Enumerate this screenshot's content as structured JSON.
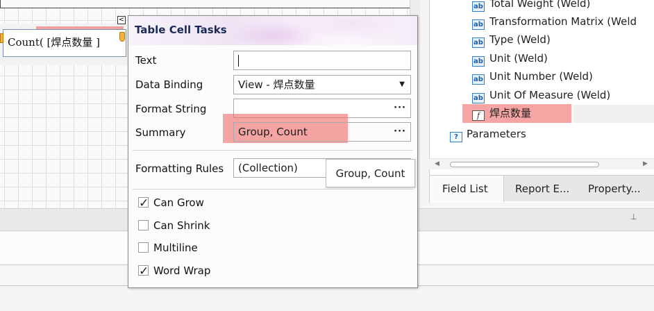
{
  "designer": {
    "cell_text": "Count( [焊点数量 ]"
  },
  "popup": {
    "title": "Table Cell Tasks",
    "rows": {
      "text_label": "Text",
      "text_value": "",
      "binding_label": "Data Binding",
      "binding_value": "View - 焊点数量",
      "format_label": "Format String",
      "format_value": "",
      "summary_label": "Summary",
      "summary_value": "Group, Count",
      "rules_label": "Formatting Rules",
      "rules_value": "(Collection)"
    },
    "ellipsis": "···",
    "dropdown_arrow": "▼",
    "tooltip": "Group, Count",
    "checks": [
      {
        "label": "Can Grow",
        "checked": true
      },
      {
        "label": "Can Shrink",
        "checked": false
      },
      {
        "label": "Multiline",
        "checked": false
      },
      {
        "label": "Word Wrap",
        "checked": true
      }
    ]
  },
  "field_list": {
    "items": [
      {
        "label": "Total Weight (Weld)",
        "icon": "text-field-icon",
        "icon_text": "ab"
      },
      {
        "label": "Transformation Matrix (Weld",
        "icon": "text-field-icon",
        "icon_text": "ab"
      },
      {
        "label": "Type (Weld)",
        "icon": "text-field-icon",
        "icon_text": "ab"
      },
      {
        "label": "Unit (Weld)",
        "icon": "text-field-icon",
        "icon_text": "ab"
      },
      {
        "label": "Unit Number (Weld)",
        "icon": "text-field-icon",
        "icon_text": "ab"
      },
      {
        "label": "Unit Of Measure (Weld)",
        "icon": "text-field-icon",
        "icon_text": "ab"
      },
      {
        "label": "焊点数量",
        "icon": "calculated-field-icon",
        "icon_text": "f"
      }
    ],
    "parameters": {
      "label": "Parameters",
      "icon": "parameters-icon",
      "icon_text": "?"
    }
  },
  "tabs": [
    {
      "label": "Field List",
      "active": true
    },
    {
      "label": "Report E...",
      "active": false
    },
    {
      "label": "Property...",
      "active": false
    }
  ],
  "colors": {
    "highlight": "#f06e6e",
    "popup_title": "#1b2b55",
    "field_icon": "#2f7fd0"
  }
}
